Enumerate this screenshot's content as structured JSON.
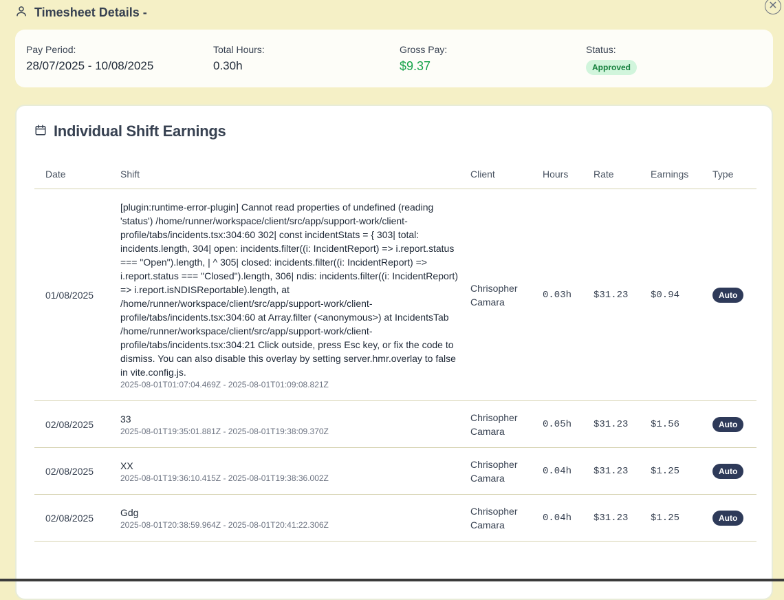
{
  "header": {
    "title": "Timesheet Details -"
  },
  "summary": {
    "pay_period_label": "Pay Period:",
    "pay_period_value": "28/07/2025 - 10/08/2025",
    "total_hours_label": "Total Hours:",
    "total_hours_value": "0.30h",
    "gross_pay_label": "Gross Pay:",
    "gross_pay_value": "$9.37",
    "status_label": "Status:",
    "status_value": "Approved"
  },
  "earnings": {
    "title": "Individual Shift Earnings",
    "columns": [
      "Date",
      "Shift",
      "Client",
      "Hours",
      "Rate",
      "Earnings",
      "Type"
    ],
    "rows": [
      {
        "date": "01/08/2025",
        "shift": "[plugin:runtime-error-plugin] Cannot read properties of undefined (reading 'status') /home/runner/workspace/client/src/app/support-work/client-profile/tabs/incidents.tsx:304:60 302| const incidentStats = { 303| total: incidents.length, 304| open: incidents.filter((i: IncidentReport) => i.report.status === \"Open\").length, | ^ 305| closed: incidents.filter((i: IncidentReport) => i.report.status === \"Closed\").length, 306| ndis: incidents.filter((i: IncidentReport) => i.report.isNDISReportable).length, at /home/runner/workspace/client/src/app/support-work/client-profile/tabs/incidents.tsx:304:60 at Array.filter (<anonymous>) at IncidentsTab /home/runner/workspace/client/src/app/support-work/client-profile/tabs/incidents.tsx:304:21 Click outside, press Esc key, or fix the code to dismiss. You can also disable this overlay by setting server.hmr.overlay to false in vite.config.js.",
        "time": "2025-08-01T01:07:04.469Z - 2025-08-01T01:09:08.821Z",
        "client": "Chrisopher Camara",
        "hours": "0.03h",
        "rate": "$31.23",
        "earnings": "$0.94",
        "type": "Auto"
      },
      {
        "date": "02/08/2025",
        "shift": "33",
        "time": "2025-08-01T19:35:01.881Z - 2025-08-01T19:38:09.370Z",
        "client": "Chrisopher Camara",
        "hours": "0.05h",
        "rate": "$31.23",
        "earnings": "$1.56",
        "type": "Auto"
      },
      {
        "date": "02/08/2025",
        "shift": "XX",
        "time": "2025-08-01T19:36:10.415Z - 2025-08-01T19:38:36.002Z",
        "client": "Chrisopher Camara",
        "hours": "0.04h",
        "rate": "$31.23",
        "earnings": "$1.25",
        "type": "Auto"
      },
      {
        "date": "02/08/2025",
        "shift": "Gdg",
        "time": "2025-08-01T20:38:59.964Z - 2025-08-01T20:41:22.306Z",
        "client": "Chrisopher Camara",
        "hours": "0.04h",
        "rate": "$31.23",
        "earnings": "$1.25",
        "type": "Auto"
      }
    ]
  },
  "icons": {
    "user": "user-icon",
    "close": "close-icon",
    "calendar": "calendar-icon"
  },
  "colors": {
    "accent_green": "#16a34a",
    "badge_dark": "#2e3a59",
    "background": "#f5f0c6"
  }
}
